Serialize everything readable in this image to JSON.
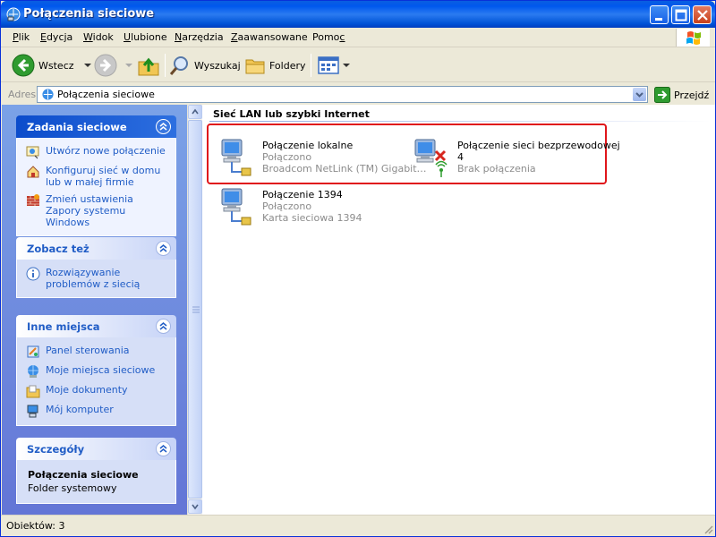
{
  "window": {
    "title": "Połączenia sieciowe"
  },
  "menu": {
    "items": [
      {
        "pre": "",
        "u": "P",
        "rest": "lik"
      },
      {
        "pre": "",
        "u": "E",
        "rest": "dycja"
      },
      {
        "pre": "",
        "u": "W",
        "rest": "idok"
      },
      {
        "pre": "",
        "u": "U",
        "rest": "lubione"
      },
      {
        "pre": "",
        "u": "N",
        "rest": "arzędzia"
      },
      {
        "pre": "",
        "u": "Z",
        "rest": "aawansowane"
      },
      {
        "pre": "Pomo",
        "u": "c",
        "rest": ""
      }
    ]
  },
  "toolbar": {
    "back_label": "Wstecz",
    "search_label": "Wyszukaj",
    "folders_label": "Foldery"
  },
  "address": {
    "label": "Adres",
    "value": "Połączenia sieciowe",
    "go_label": "Przejdź"
  },
  "sidebar": {
    "tasks": {
      "title": "Zadania sieciowe",
      "items": [
        {
          "label": "Utwórz nowe połączenie",
          "icon": "new-connection-icon"
        },
        {
          "label": "Konfiguruj sieć w domu lub w małej firmie",
          "icon": "home-network-icon"
        },
        {
          "label": "Zmień ustawienia Zapory systemu Windows",
          "icon": "firewall-icon"
        }
      ]
    },
    "see_also": {
      "title": "Zobacz też",
      "items": [
        {
          "label": "Rozwiązywanie problemów z siecią",
          "icon": "info-icon"
        }
      ]
    },
    "other_places": {
      "title": "Inne miejsca",
      "items": [
        {
          "label": "Panel sterowania",
          "icon": "control-panel-icon"
        },
        {
          "label": "Moje miejsca sieciowe",
          "icon": "network-places-icon"
        },
        {
          "label": "Moje dokumenty",
          "icon": "documents-folder-icon"
        },
        {
          "label": "Mój komputer",
          "icon": "computer-icon"
        }
      ]
    },
    "details": {
      "title": "Szczegóły",
      "name": "Połączenia sieciowe",
      "type": "Folder systemowy"
    }
  },
  "content": {
    "group_title": "Sieć LAN lub szybki Internet",
    "connections": [
      {
        "name": "Połączenie lokalne",
        "status": "Połączono",
        "device": "Broadcom NetLink (TM) Gigabit…"
      },
      {
        "name": "Połączenie sieci bezprzewodowej",
        "name_line2": "4",
        "status": "Brak połączenia"
      },
      {
        "name": "Połączenie 1394",
        "status": "Połączono",
        "device": "Karta sieciowa 1394"
      }
    ]
  },
  "status": {
    "text": "Obiektów: 3"
  },
  "colors": {
    "titlebar": "#0058ee",
    "link": "#215dc6",
    "highlight_border": "#e0161b",
    "sidepanel": "#6f8cdd"
  }
}
